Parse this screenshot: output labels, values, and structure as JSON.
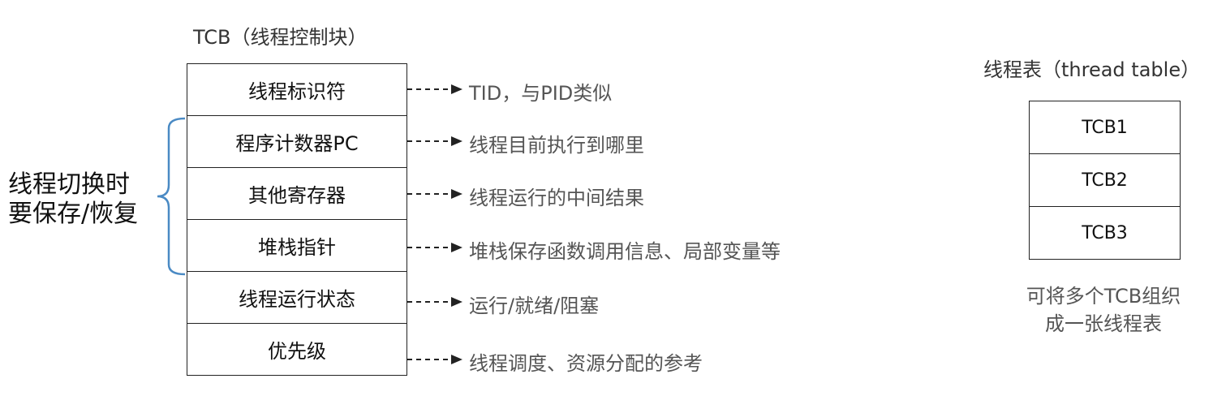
{
  "tcb": {
    "title": "TCB（线程控制块）",
    "fields": [
      "线程标识符",
      "程序计数器PC",
      "其他寄存器",
      "堆栈指针",
      "线程运行状态",
      "优先级"
    ],
    "notes": [
      "TID，与PID类似",
      "线程目前执行到哪里",
      "线程运行的中间结果",
      "堆栈保存函数调用信息、局部变量等",
      "运行/就绪/阻塞",
      "线程调度、资源分配的参考"
    ],
    "switch_label": [
      "线程切换时",
      "要保存/恢复"
    ]
  },
  "thread_table": {
    "title": "线程表（thread table）",
    "rows": [
      "TCB1",
      "TCB2",
      "TCB3"
    ],
    "caption": [
      "可将多个TCB组织",
      "成一张线程表"
    ]
  },
  "colors": {
    "brace": "#4a8ac4",
    "line": "#222222"
  }
}
